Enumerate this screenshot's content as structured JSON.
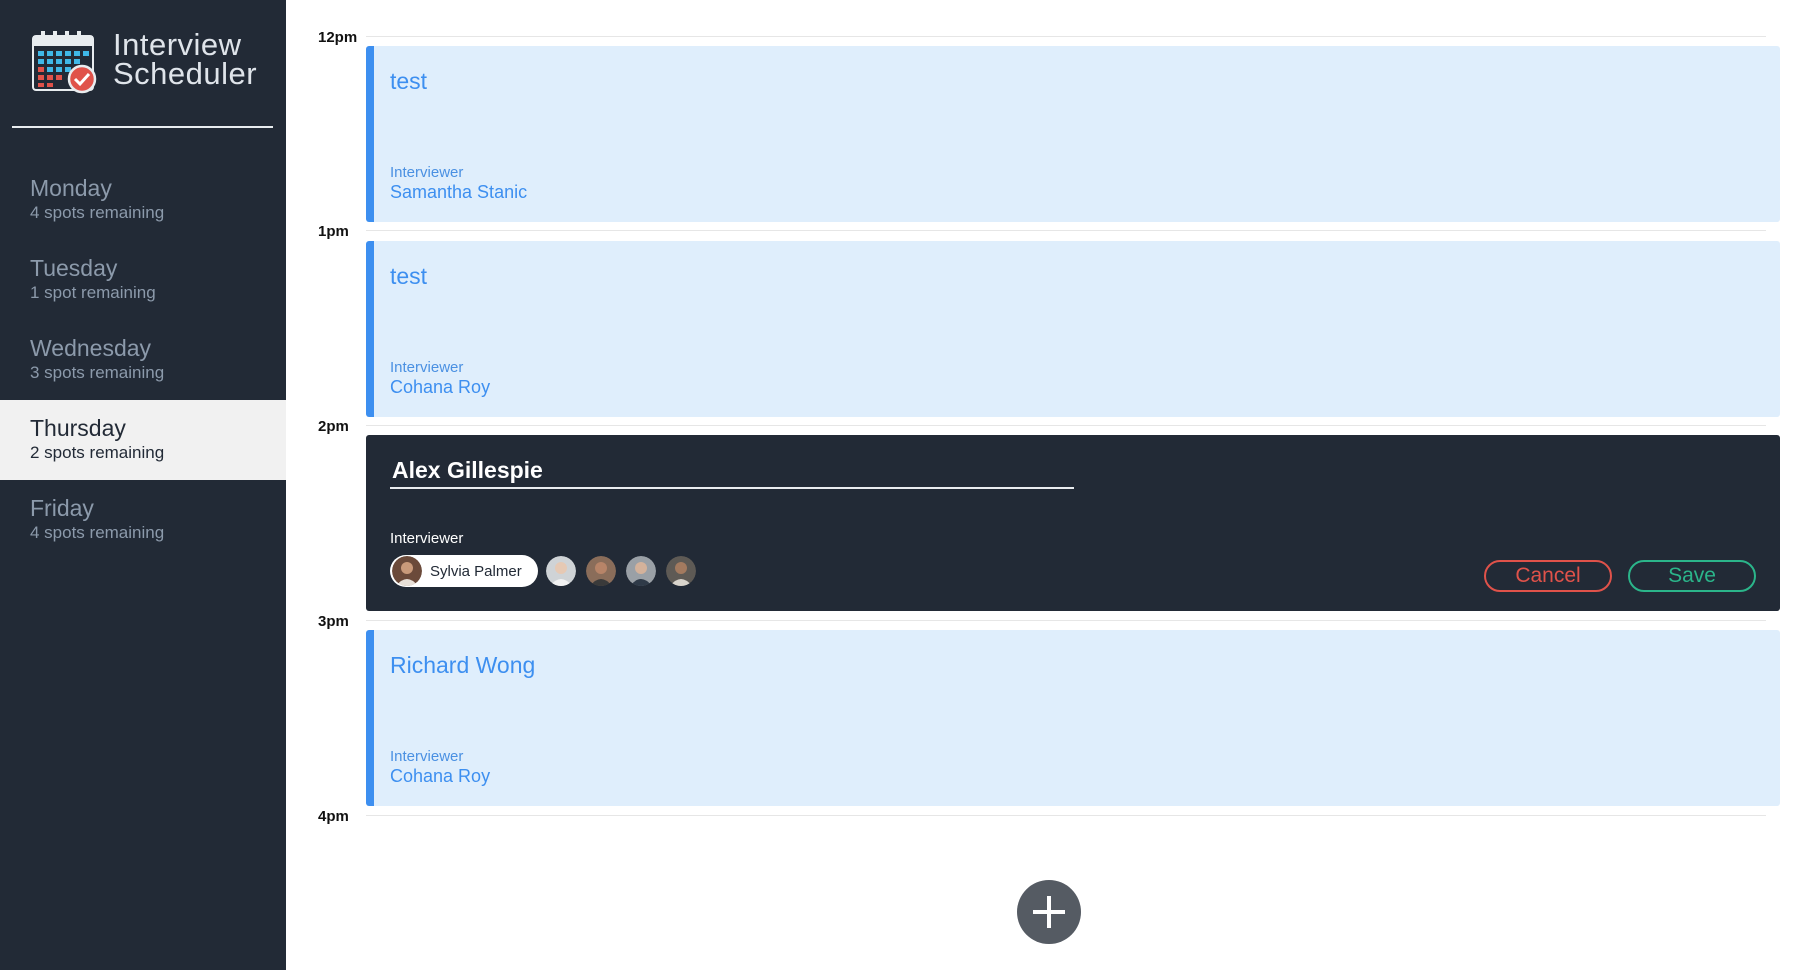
{
  "sidebar": {
    "brand_line1": "Interview",
    "brand_line2": "Scheduler",
    "days": [
      {
        "name": "Monday",
        "spots": "4 spots remaining",
        "selected": false
      },
      {
        "name": "Tuesday",
        "spots": "1 spot remaining",
        "selected": false
      },
      {
        "name": "Wednesday",
        "spots": "3 spots remaining",
        "selected": false
      },
      {
        "name": "Thursday",
        "spots": "2 spots remaining",
        "selected": true
      },
      {
        "name": "Friday",
        "spots": "4 spots remaining",
        "selected": false
      }
    ]
  },
  "schedule": {
    "times": [
      "12pm",
      "1pm",
      "2pm",
      "3pm",
      "4pm"
    ],
    "appointments": [
      {
        "student": "test",
        "interviewer_label": "Interviewer",
        "interviewer": "Samantha Stanic"
      },
      {
        "student": "test",
        "interviewer_label": "Interviewer",
        "interviewer": "Cohana Roy"
      },
      {
        "student": "Richard Wong",
        "interviewer_label": "Interviewer",
        "interviewer": "Cohana Roy"
      }
    ],
    "edit_form": {
      "student_value": "Alex Gillespie",
      "interviewer_label": "Interviewer",
      "selected_interviewer": "Sylvia Palmer",
      "cancel_label": "Cancel",
      "save_label": "Save"
    }
  },
  "icons": {
    "logo": "calendar-check-icon",
    "add": "plus-icon"
  },
  "colors": {
    "sidebar_bg": "#222a36",
    "appointment_bg": "#dfeefc",
    "appointment_accent": "#3d8ff0",
    "cancel": "#e0524a",
    "save": "#2bb58a"
  }
}
